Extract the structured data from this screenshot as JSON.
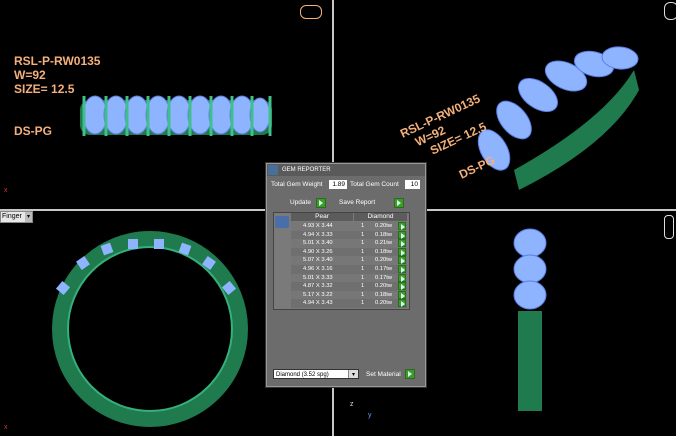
{
  "viewports": {
    "top_left": {
      "label_lines": [
        "RSL-P-RW0135",
        "W=92",
        "SIZE= 12.5",
        "DS-PG"
      ],
      "axis_marker": "x"
    },
    "top_right": {
      "label_lines": [
        "RSL-P-RW0135",
        "W=92",
        "SIZE= 12.5",
        "DS-PG"
      ]
    },
    "bottom_left": {
      "view_dropdown": "Finger",
      "axis_marker": "x"
    },
    "bottom_right": {
      "axis_labels": [
        "z",
        "y"
      ]
    }
  },
  "gem_reporter": {
    "title": "GEM REPORTER",
    "total_weight_label": "Total Gem Weight",
    "total_weight_value": "1.89",
    "total_count_label": "Total Gem Count",
    "total_count_value": "10",
    "update_label": "Update",
    "save_report_label": "Save Report",
    "table": {
      "headers": [
        "Pear",
        "Diamond"
      ],
      "rows": [
        {
          "size": "4.93 X 3.44",
          "qty": "1",
          "weight": "0.20tw"
        },
        {
          "size": "4.94 X 3.33",
          "qty": "1",
          "weight": "0.18tw"
        },
        {
          "size": "5.01 X 3.40",
          "qty": "1",
          "weight": "0.21tw"
        },
        {
          "size": "4.90 X 3.26",
          "qty": "1",
          "weight": "0.18tw"
        },
        {
          "size": "5.07 X 3.40",
          "qty": "1",
          "weight": "0.20tw"
        },
        {
          "size": "4.96 X 3.16",
          "qty": "1",
          "weight": "0.17tw"
        },
        {
          "size": "5.01 X 3.33",
          "qty": "1",
          "weight": "0.17tw"
        },
        {
          "size": "4.87 X 3.32",
          "qty": "1",
          "weight": "0.20tw"
        },
        {
          "size": "5.17 X 3.22",
          "qty": "1",
          "weight": "0.18tw"
        },
        {
          "size": "4.94 X 3.43",
          "qty": "1",
          "weight": "0.20tw"
        }
      ]
    },
    "material_select": "Diamond   (3.52 spg)",
    "set_material_label": "Set Material"
  },
  "colors": {
    "metal": "#2f9e6a",
    "gem": "#8fb4ff",
    "label": "#f5b07a",
    "background": "#000000"
  }
}
